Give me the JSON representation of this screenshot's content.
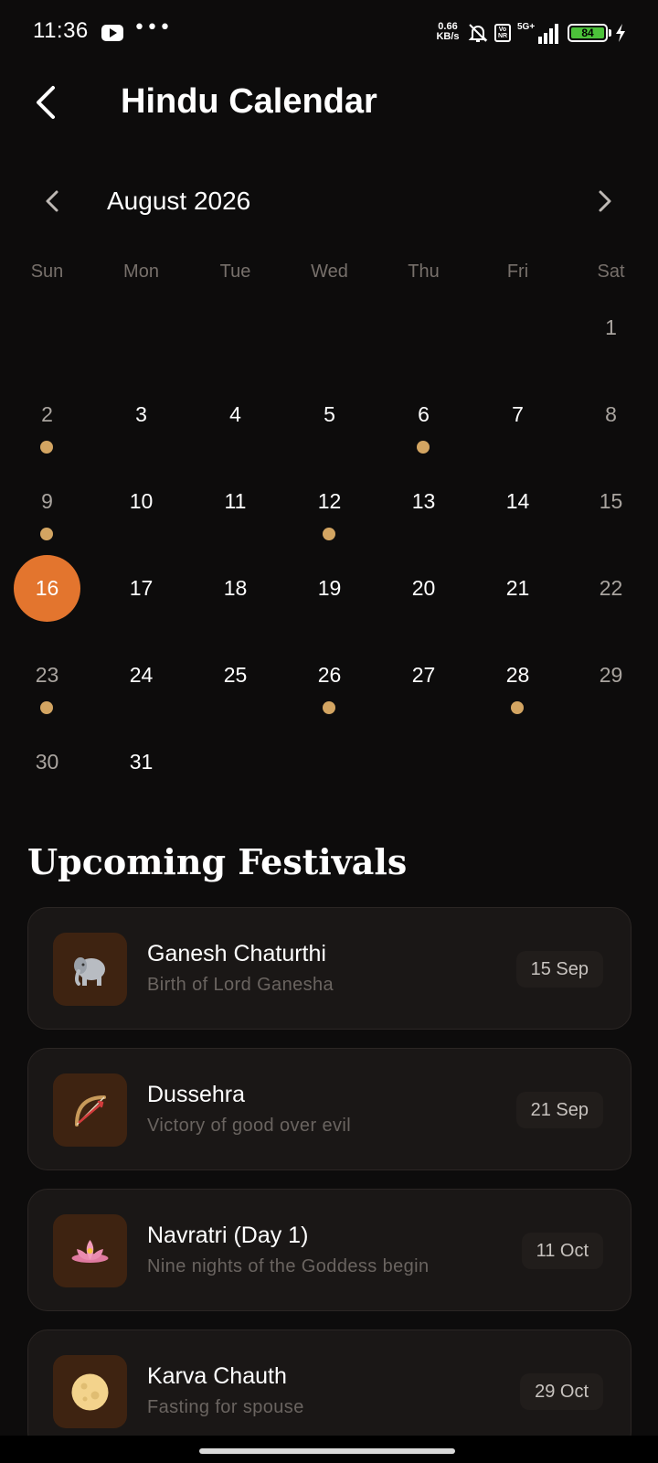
{
  "status_bar": {
    "time": "11:36",
    "net_speed_value": "0.66",
    "net_speed_unit": "KB/s",
    "volte": "Vo NR",
    "network": "5G+",
    "battery": "84",
    "icons": [
      "youtube-icon",
      "more-icon",
      "bell-muted-icon",
      "volte-icon",
      "signal-icon",
      "battery-icon",
      "charging-icon"
    ]
  },
  "header": {
    "title": "Hindu Calendar",
    "back_icon": "chevron-left-icon"
  },
  "calendar": {
    "month_label": "August 2026",
    "weekdays": [
      "Sun",
      "Mon",
      "Tue",
      "Wed",
      "Thu",
      "Fri",
      "Sat"
    ],
    "days": {
      "d1": "1",
      "d2": "2",
      "d3": "3",
      "d4": "4",
      "d5": "5",
      "d6": "6",
      "d7": "7",
      "d8": "8",
      "d9": "9",
      "d10": "10",
      "d11": "11",
      "d12": "12",
      "d13": "13",
      "d14": "14",
      "d15": "15",
      "d16": "16",
      "d17": "17",
      "d18": "18",
      "d19": "19",
      "d20": "20",
      "d21": "21",
      "d22": "22",
      "d23": "23",
      "d24": "24",
      "d25": "25",
      "d26": "26",
      "d27": "27",
      "d28": "28",
      "d29": "29",
      "d30": "30",
      "d31": "31"
    },
    "selected_day": "16",
    "event_days": [
      "2",
      "6",
      "9",
      "12",
      "23",
      "26",
      "28"
    ],
    "colors": {
      "selected": "#e3752e",
      "event_dot": "#d3a562"
    }
  },
  "festivals": {
    "title": "Upcoming Festivals",
    "items": [
      {
        "name": "Ganesh Chaturthi",
        "description": "Birth of Lord Ganesha",
        "date": "15 Sep",
        "icon": "elephant-icon"
      },
      {
        "name": "Dussehra",
        "description": "Victory of good over evil",
        "date": "21 Sep",
        "icon": "bow-arrow-icon"
      },
      {
        "name": "Navratri (Day 1)",
        "description": "Nine nights of the Goddess begin",
        "date": "11 Oct",
        "icon": "lotus-icon"
      },
      {
        "name": "Karva Chauth",
        "description": "Fasting for spouse",
        "date": "29 Oct",
        "icon": "full-moon-icon"
      }
    ]
  }
}
